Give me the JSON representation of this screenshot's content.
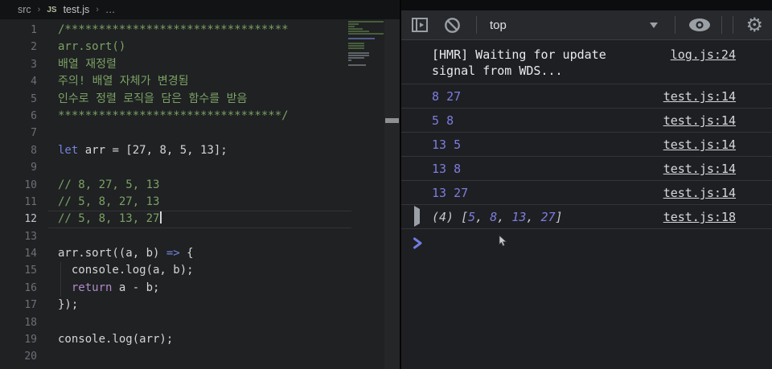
{
  "editor": {
    "breadcrumb": {
      "root": "src",
      "sep1": "›",
      "file_badge": "JS",
      "file": "test.js",
      "sep2": "›",
      "more": "…"
    },
    "lines": [
      {
        "n": "1",
        "tokens": [
          [
            "cmt",
            "/*********************************"
          ]
        ]
      },
      {
        "n": "2",
        "tokens": [
          [
            "cmt",
            "arr.sort()"
          ]
        ]
      },
      {
        "n": "3",
        "tokens": [
          [
            "cmt",
            "배열 재정렬"
          ]
        ]
      },
      {
        "n": "4",
        "tokens": [
          [
            "cmt",
            "주의! 배열 자체가 변경됨"
          ]
        ]
      },
      {
        "n": "5",
        "tokens": [
          [
            "cmt",
            "인수로 정렬 로직을 담은 함수를 받음"
          ]
        ]
      },
      {
        "n": "6",
        "tokens": [
          [
            "cmt",
            "*********************************/"
          ]
        ]
      },
      {
        "n": "7",
        "tokens": []
      },
      {
        "n": "8",
        "tokens": [
          [
            "kw",
            "let"
          ],
          [
            "pl",
            " arr = [27, 8, 5, 13];"
          ]
        ]
      },
      {
        "n": "9",
        "tokens": []
      },
      {
        "n": "10",
        "tokens": [
          [
            "cmt",
            "// 8, 27, 5, 13"
          ]
        ]
      },
      {
        "n": "11",
        "tokens": [
          [
            "cmt",
            "// 5, 8, 27, 13"
          ]
        ]
      },
      {
        "n": "12",
        "tokens": [
          [
            "cmt",
            "// 5, 8, 13, 27"
          ]
        ],
        "current": true,
        "caret": true
      },
      {
        "n": "13",
        "tokens": []
      },
      {
        "n": "14",
        "tokens": [
          [
            "pl",
            "arr.sort((a, b) "
          ],
          [
            "kw",
            "=>"
          ],
          [
            "pl",
            " {"
          ]
        ]
      },
      {
        "n": "15",
        "tokens": [
          [
            "pl",
            "  console.log(a, b);"
          ]
        ],
        "guide": true
      },
      {
        "n": "16",
        "tokens": [
          [
            "pl",
            "  "
          ],
          [
            "ret",
            "return"
          ],
          [
            "pl",
            " a - b;"
          ]
        ],
        "guide": true
      },
      {
        "n": "17",
        "tokens": [
          [
            "pl",
            "});"
          ]
        ]
      },
      {
        "n": "18",
        "tokens": []
      },
      {
        "n": "19",
        "tokens": [
          [
            "pl",
            "console.log(arr);"
          ]
        ]
      },
      {
        "n": "20",
        "tokens": []
      }
    ]
  },
  "devtools": {
    "toolbar": {
      "context_selector": "top"
    },
    "console": {
      "rows": [
        {
          "type": "log",
          "text": "[HMR] Waiting for update signal from WDS...",
          "link": "log.js:24"
        },
        {
          "type": "nums",
          "values": [
            "8",
            "27"
          ],
          "link": "test.js:14"
        },
        {
          "type": "nums",
          "values": [
            "5",
            "8"
          ],
          "link": "test.js:14"
        },
        {
          "type": "nums",
          "values": [
            "13",
            "5"
          ],
          "link": "test.js:14"
        },
        {
          "type": "nums",
          "values": [
            "13",
            "8"
          ],
          "link": "test.js:14"
        },
        {
          "type": "nums",
          "values": [
            "13",
            "27"
          ],
          "link": "test.js:14"
        },
        {
          "type": "array",
          "count": "(4)",
          "items": [
            "5",
            "8",
            "13",
            "27"
          ],
          "link": "test.js:18"
        }
      ]
    }
  },
  "colors": {
    "console_number": "#7e7cdf",
    "comment_green": "#7ba163",
    "keyword_blue": "#7583dd",
    "prompt_blue": "#6f7ce0",
    "toolbar_icon": "#9aa0a6"
  }
}
